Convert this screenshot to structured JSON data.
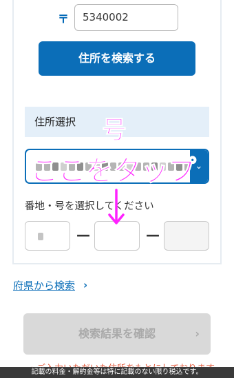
{
  "postal": {
    "mark": "〒",
    "value": "5340002"
  },
  "search_button": {
    "label": "住所を検索する"
  },
  "address_select": {
    "heading": "住所選択",
    "chevron": "⌄"
  },
  "lot_number": {
    "label": "番地・号を選択してください",
    "separator": "—"
  },
  "overlay": {
    "go": "号",
    "tap": "ここをタップ",
    "color": "#ff22ff"
  },
  "prefecture_link": {
    "label": "府県から検索",
    "chevron": "›"
  },
  "confirm_button": {
    "label": "検索結果を確認",
    "chevron": "›"
  },
  "footer": {
    "peek_text": "・ご入力いただいた住所をもとにしております。",
    "note": "記載の料金・解約金等は特に記載のない限り税込です。"
  },
  "colors": {
    "brand_blue": "#0b6eb8",
    "section_bg": "#e4eff9",
    "disabled_bg": "#d9d9d9"
  }
}
